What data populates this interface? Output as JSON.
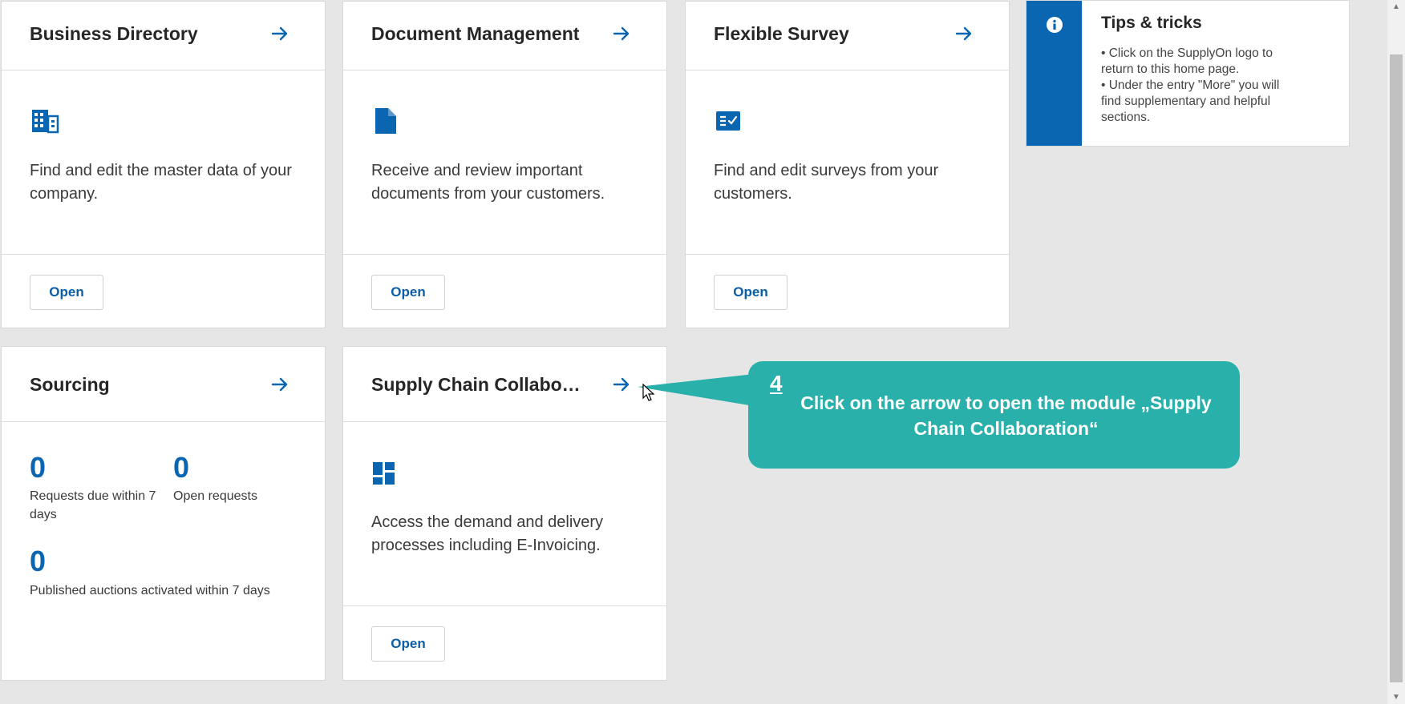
{
  "cards": [
    {
      "title": "Business Directory",
      "icon": "building-icon",
      "description": "Find and edit the master data of your company.",
      "open_label": "Open"
    },
    {
      "title": "Document Management",
      "icon": "document-icon",
      "description": "Receive and review important documents from your customers.",
      "open_label": "Open"
    },
    {
      "title": "Flexible Survey",
      "icon": "survey-checklist-icon",
      "description": "Find and edit surveys from your customers.",
      "open_label": "Open"
    },
    {
      "title": "Sourcing",
      "stats": [
        {
          "value": "0",
          "label": "Requests due within 7 days"
        },
        {
          "value": "0",
          "label": "Open requests"
        },
        {
          "value": "0",
          "label": "Published auctions activated within 7 days"
        }
      ]
    },
    {
      "title": "Supply Chain Collabo…",
      "icon": "dashboard-icon",
      "description": "Access the demand and delivery processes including E-Invoicing.",
      "open_label": "Open"
    }
  ],
  "tips": {
    "title": "Tips & tricks",
    "lines": [
      "• Click on the SupplyOn logo to return to this home page.",
      "• Under the entry \"More\" you will find supplementary and helpful sections."
    ]
  },
  "callout": {
    "step": "4",
    "text": "Click on the arrow to open the module „Supply Chain Collaboration“"
  },
  "colors": {
    "accent": "#0a66b0",
    "callout": "#2ab0ab",
    "background": "#e6e6e6"
  }
}
